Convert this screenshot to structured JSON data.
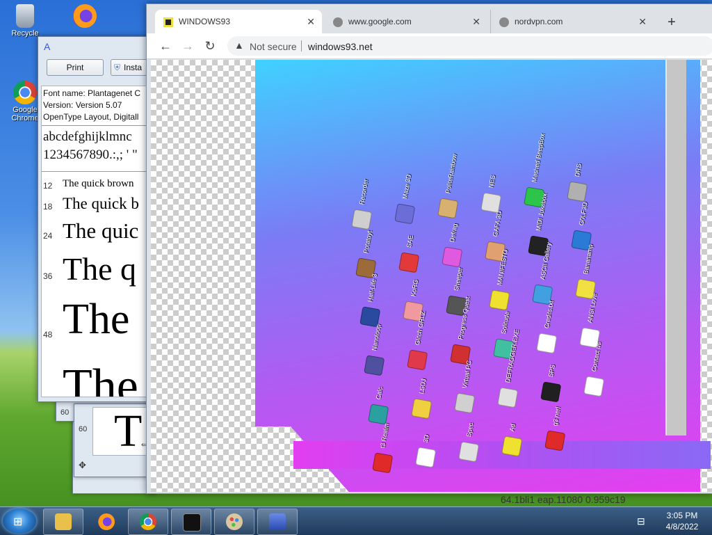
{
  "desktop": {
    "icons": [
      {
        "label": "Recycle"
      },
      {
        "label": "Google Chrome"
      }
    ],
    "background_text": "64.1bli1 eap.11080 0.959c19"
  },
  "font_viewer": {
    "print_button": "Print",
    "install_button": "Insta",
    "info_lines": [
      "Font name: Plantagenet C",
      "Version: Version 5.07",
      "OpenType Layout, Digitall"
    ],
    "alphabet": "abcdefghijklmnc",
    "numerals": "1234567890.:,; ' \"",
    "sizes": [
      {
        "size": "12",
        "text": "The quick brown"
      },
      {
        "size": "18",
        "text": "The quick b"
      },
      {
        "size": "24",
        "text": "The quic"
      },
      {
        "size": "36",
        "text": "The q"
      },
      {
        "size": "48",
        "text": "The"
      },
      {
        "size": "",
        "text": "The"
      }
    ],
    "back_sizes": [
      "60",
      "60"
    ],
    "back_sample": "T"
  },
  "browser": {
    "tabs": [
      {
        "label": "WINDOWS93",
        "active": true
      },
      {
        "label": "www.google.com",
        "active": false
      },
      {
        "label": "nordvpn.com",
        "active": false
      }
    ],
    "new_tab": "+",
    "security_label": "Not secure",
    "url": "windows93.net"
  },
  "windows93": {
    "icons": [
      {
        "label": "Recorder",
        "color": "#cfcfcf"
      },
      {
        "label": "Maze 3D",
        "color": "#6d6dd8"
      },
      {
        "label": "PoliteRainbow",
        "color": "#d8b070"
      },
      {
        "label": "NES",
        "color": "#e0e0e0"
      },
      {
        "label": "Mashed BeepBox",
        "color": "#2cc44a"
      },
      {
        "label": "DRS",
        "color": "#b0b0b0"
      },
      {
        "label": "Potatoyt",
        "color": "#9b6b3a"
      },
      {
        "label": "SAE",
        "color": "#e23a3a"
      },
      {
        "label": "Defrag",
        "color": "#e05ae0"
      },
      {
        "label": "GAFA 3D",
        "color": "#e0a070"
      },
      {
        "label": "MIDI Jukebox",
        "color": "#222222"
      },
      {
        "label": "G0LF3D",
        "color": "#2a7ad6"
      },
      {
        "label": "Half-Life 3",
        "color": "#2a4aa0"
      },
      {
        "label": "KoRG",
        "color": "#f09aa0"
      },
      {
        "label": "Sheeper",
        "color": "#555555"
      },
      {
        "label": "MANIFESTO",
        "color": "#f0e030"
      },
      {
        "label": "ASCII Gallery",
        "color": "#40a0e0"
      },
      {
        "label": "Bananamp",
        "color": "#f0e040"
      },
      {
        "label": "Nanoloop",
        "color": "#5050a0"
      },
      {
        "label": "Glitch GRLZ",
        "color": "#e03a4a"
      },
      {
        "label": "Progress Quest",
        "color": "#d03030"
      },
      {
        "label": "Solitude",
        "color": "#40c0a0"
      },
      {
        "label": "Credits.txt",
        "color": "#ffffff"
      },
      {
        "label": "ANSI Love",
        "color": "#ffffff"
      },
      {
        "label": "Calc",
        "color": "#2aa0a0"
      },
      {
        "label": "LSDJ",
        "color": "#f0d040"
      },
      {
        "label": "Virtual PC",
        "color": "#d0d0d0"
      },
      {
        "label": "DEFRAGGER.EXE",
        "color": "#e0e0e0"
      },
      {
        "label": "SPS",
        "color": "#202020"
      },
      {
        "label": "Contact us",
        "color": "#ffffff"
      },
      {
        "label": "t3 Realm",
        "color": "#e02a2a"
      },
      {
        "label": "3D",
        "color": "#ffffff"
      },
      {
        "label": "Spec",
        "color": "#e0e0e0"
      },
      {
        "label": "Ad",
        "color": "#f0e030"
      },
      {
        "label": "g3 nerl",
        "color": "#e02a2a"
      }
    ]
  },
  "taskbar": {
    "items": [
      {
        "name": "explorer",
        "color": "#e8c04a"
      },
      {
        "name": "firefox",
        "color": "#f07a2a"
      },
      {
        "name": "chrome",
        "color": "#3a9a4a"
      },
      {
        "name": "cmd",
        "color": "#111111"
      },
      {
        "name": "paint",
        "color": "#7ab0e0"
      },
      {
        "name": "font-viewer",
        "color": "#3a5ad0"
      }
    ],
    "time": "3:05 PM",
    "date": "4/8/2022"
  }
}
